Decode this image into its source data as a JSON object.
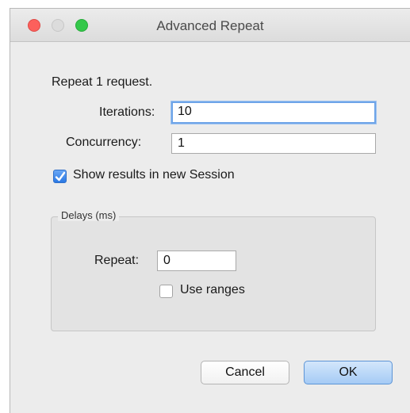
{
  "window": {
    "title": "Advanced Repeat",
    "traffic_lights": [
      "close",
      "minimize",
      "zoom"
    ]
  },
  "header": {
    "repeat_text": "Repeat 1 request."
  },
  "fields": {
    "iterations_label": "Iterations:",
    "iterations_value": "10",
    "concurrency_label": "Concurrency:",
    "concurrency_value": "1"
  },
  "show_results": {
    "label": "Show results in new Session",
    "checked": true
  },
  "delays": {
    "legend": "Delays (ms)",
    "repeat_label": "Repeat:",
    "repeat_value": "0",
    "use_ranges_label": "Use ranges",
    "use_ranges_checked": false
  },
  "buttons": {
    "cancel": "Cancel",
    "ok": "OK"
  },
  "colors": {
    "accent": "#6ea4e8",
    "close": "#fc605c",
    "zoom": "#34c84a"
  }
}
